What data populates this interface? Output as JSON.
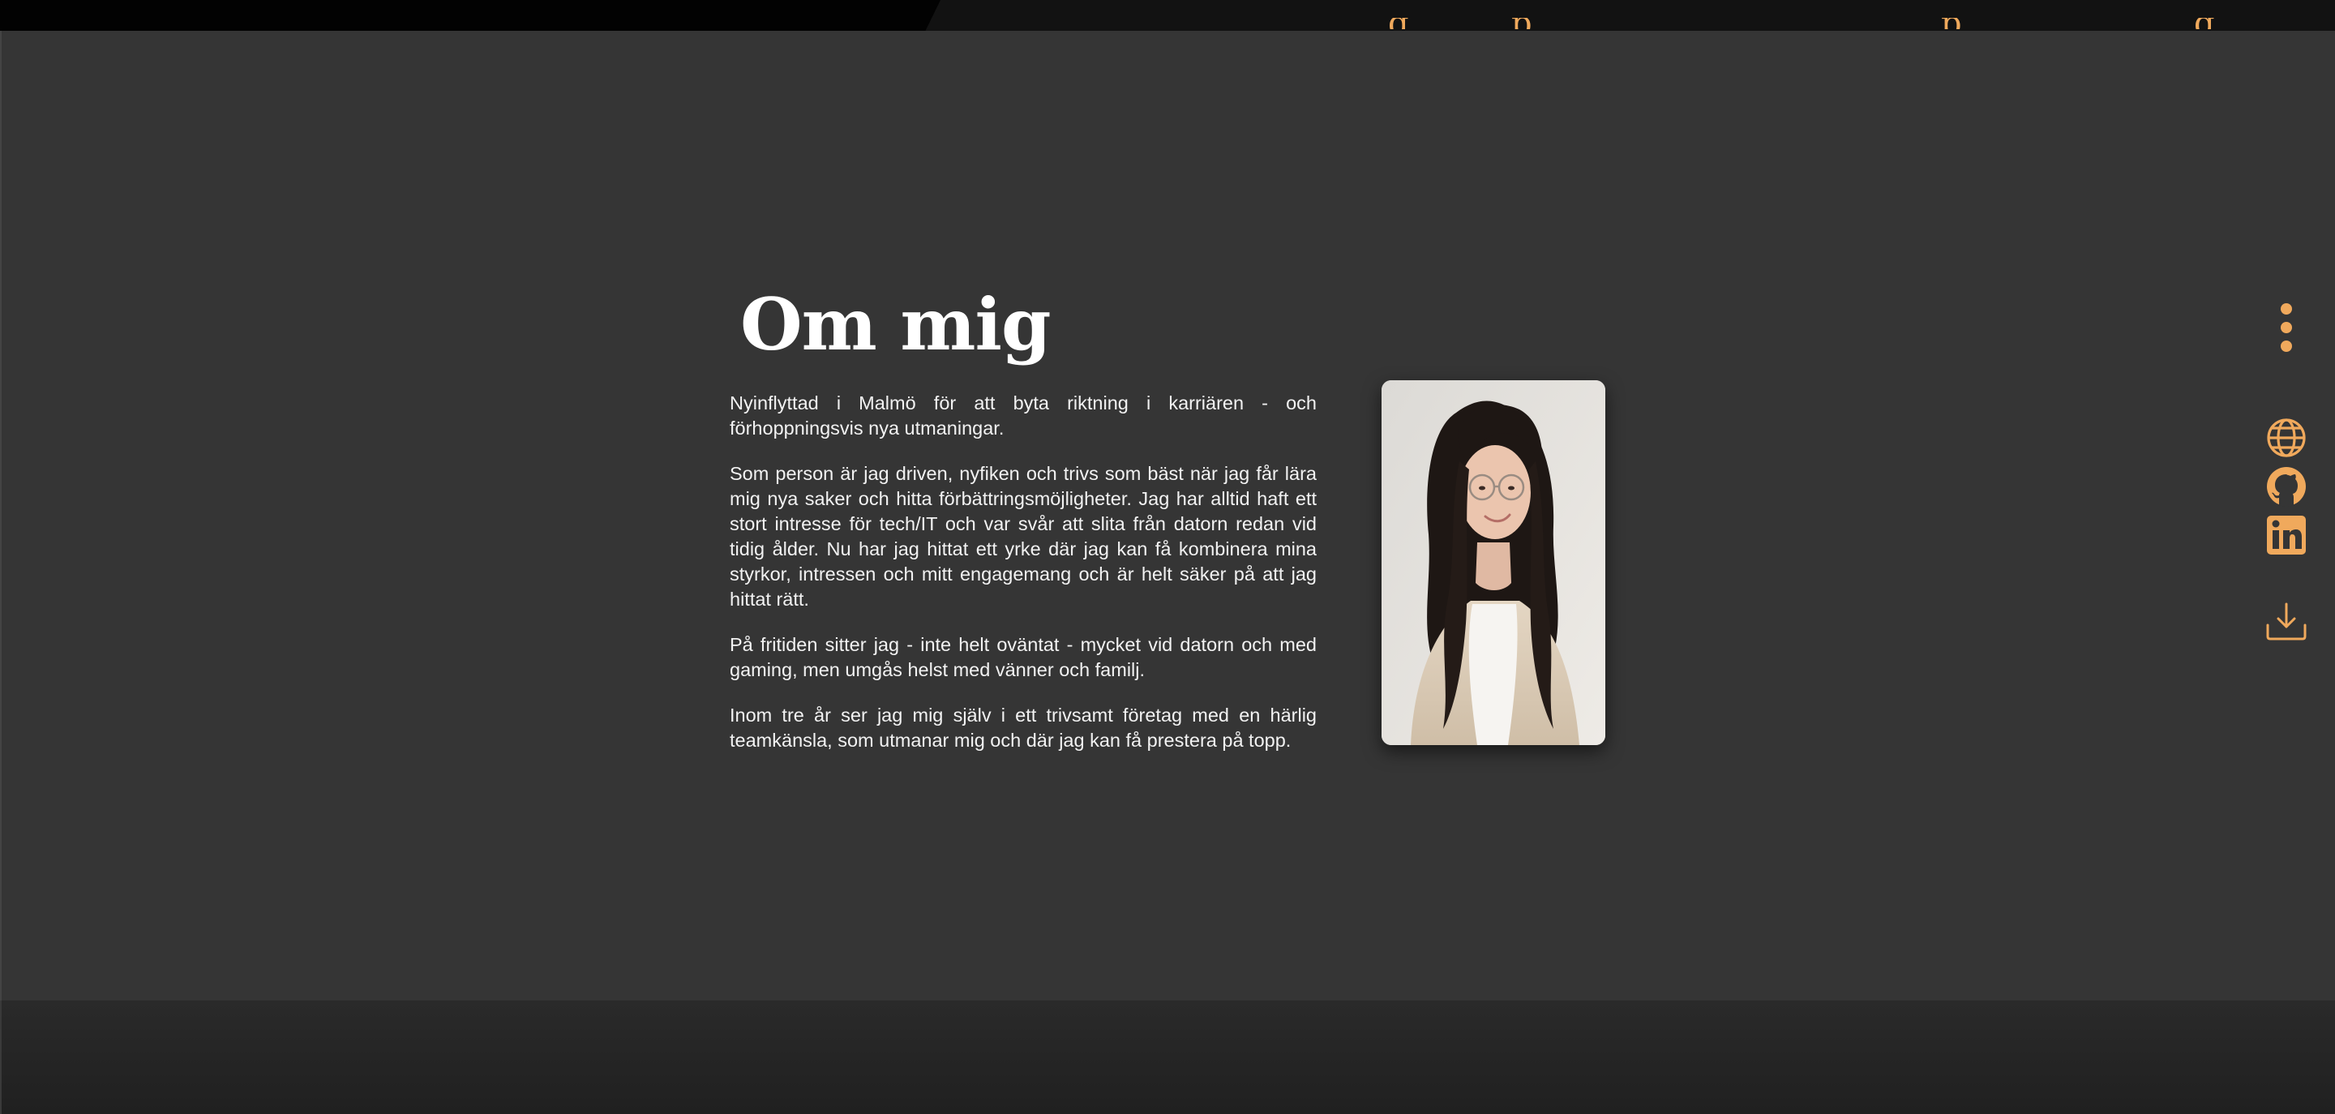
{
  "colors": {
    "accent": "#f0a95c",
    "background": "#353535",
    "text": "#f2f2f2",
    "topbar": "#121212"
  },
  "nav": {
    "glyphs": [
      "g",
      "p",
      "p",
      "g"
    ]
  },
  "about": {
    "title": "Om mig",
    "paragraphs": [
      "Nyinflyttad i Malmö för att byta riktning i karriären - och förhoppningsvis nya utmaningar.",
      "Som person är jag driven, nyfiken och trivs som bäst när jag får lära mig nya saker och hitta förbättringsmöjligheter. Jag har alltid haft ett stort intresse för tech/IT och var svår att slita från datorn redan vid tidig ålder. Nu har jag hittat ett yrke där jag kan få kombinera mina styrkor, intressen och mitt engagemang och är helt säker på att jag hittat rätt.",
      "På fritiden sitter jag - inte helt oväntat - mycket vid datorn och med gaming, men umgås helst med vänner och familj.",
      "Inom tre år ser jag mig själv i ett trivsamt företag med en härlig teamkänsla, som utmanar mig och där jag kan få prestera på topp."
    ]
  },
  "sidebar": {
    "icons": [
      "more-vertical-icon",
      "globe-icon",
      "github-icon",
      "linkedin-icon",
      "download-icon"
    ]
  }
}
